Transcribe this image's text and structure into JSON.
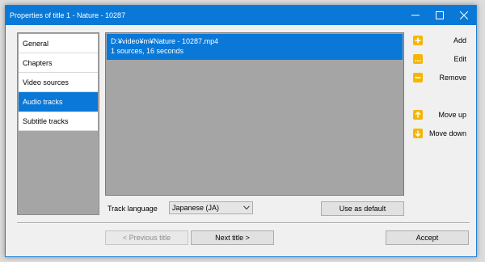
{
  "window": {
    "title": "Properties of title 1 - Nature - 10287"
  },
  "nav": {
    "items": [
      {
        "label": "General"
      },
      {
        "label": "Chapters"
      },
      {
        "label": "Video sources"
      },
      {
        "label": "Audio tracks",
        "selected": true
      },
      {
        "label": "Subtitle tracks"
      }
    ]
  },
  "tracks": {
    "items": [
      {
        "path": "D:¥video¥m¥Nature - 10287.mp4",
        "info": "1 sources, 16 seconds"
      }
    ]
  },
  "side_buttons": {
    "add": "Add",
    "edit": "Edit",
    "remove": "Remove",
    "move_up": "Move up",
    "move_down": "Move down"
  },
  "language": {
    "label": "Track language",
    "value": "Japanese (JA)",
    "default_button": "Use as default"
  },
  "footer": {
    "prev": "< Previous title",
    "next": "Next title >",
    "accept": "Accept"
  },
  "colors": {
    "accent": "#0a78d7",
    "icon": "#f7b500",
    "panel_gray": "#a5a5a5"
  }
}
